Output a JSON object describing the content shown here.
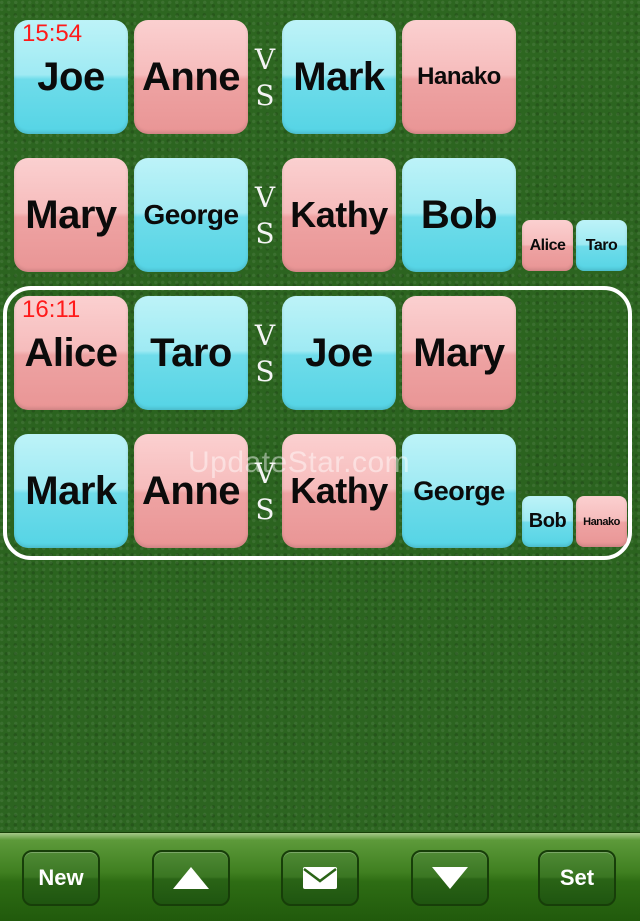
{
  "rounds": [
    {
      "time": "15:54",
      "courts": [
        {
          "players": [
            {
              "name": "Joe",
              "color": "blue"
            },
            {
              "name": "Anne",
              "color": "pink"
            },
            {
              "name": "Mark",
              "color": "blue"
            },
            {
              "name": "Hanako",
              "color": "pink"
            }
          ],
          "vs": [
            "V",
            "S"
          ],
          "resting": []
        },
        {
          "players": [
            {
              "name": "Mary",
              "color": "pink"
            },
            {
              "name": "George",
              "color": "blue"
            },
            {
              "name": "Kathy",
              "color": "pink"
            },
            {
              "name": "Bob",
              "color": "blue"
            }
          ],
          "vs": [
            "V",
            "S"
          ],
          "resting": [
            {
              "name": "Alice",
              "color": "pink"
            },
            {
              "name": "Taro",
              "color": "blue"
            }
          ]
        }
      ]
    },
    {
      "time": "16:11",
      "courts": [
        {
          "players": [
            {
              "name": "Alice",
              "color": "pink"
            },
            {
              "name": "Taro",
              "color": "blue"
            },
            {
              "name": "Joe",
              "color": "blue"
            },
            {
              "name": "Mary",
              "color": "pink"
            }
          ],
          "vs": [
            "V",
            "S"
          ],
          "resting": []
        },
        {
          "players": [
            {
              "name": "Mark",
              "color": "blue"
            },
            {
              "name": "Anne",
              "color": "pink"
            },
            {
              "name": "Kathy",
              "color": "pink"
            },
            {
              "name": "George",
              "color": "blue"
            }
          ],
          "vs": [
            "V",
            "S"
          ],
          "resting": [
            {
              "name": "Bob",
              "color": "blue"
            },
            {
              "name": "Hanako",
              "color": "pink"
            }
          ]
        }
      ]
    }
  ],
  "watermark": "UpdateStar.com",
  "toolbar": {
    "new_label": "New",
    "up_icon": "triangle-up-icon",
    "mail_icon": "envelope-icon",
    "down_icon": "triangle-down-icon",
    "set_label": "Set"
  },
  "colors": {
    "blue": "#6fdcea",
    "pink": "#f2b0b0",
    "time": "#ff1a1a",
    "felt": "#2d6620"
  }
}
